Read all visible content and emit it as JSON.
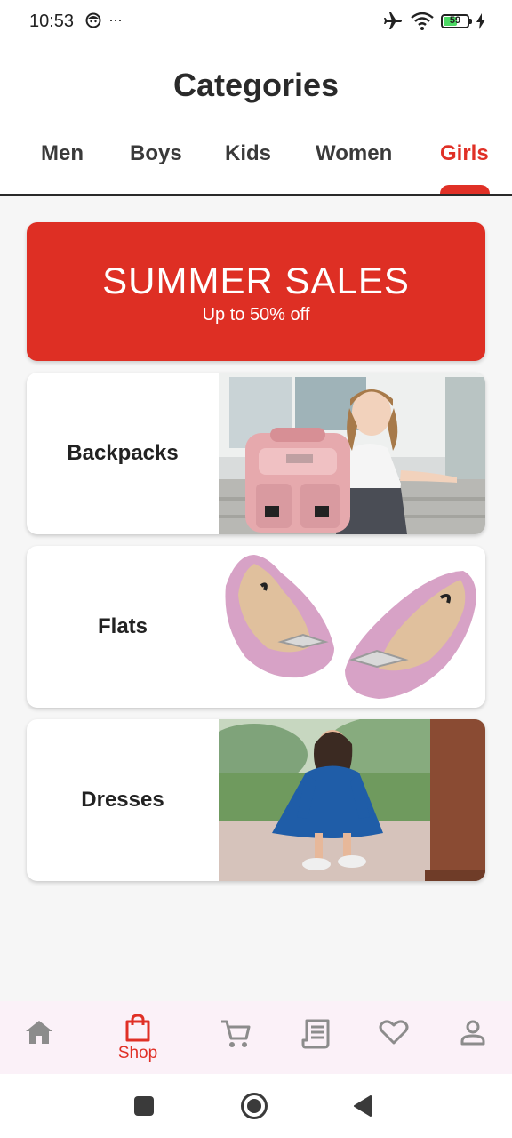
{
  "status_bar": {
    "time": "10:53",
    "more": "···",
    "battery": "59",
    "battery_level": 0.59
  },
  "header": {
    "title": "Categories"
  },
  "tabs": [
    {
      "label": "Men",
      "active": false
    },
    {
      "label": "Boys",
      "active": false
    },
    {
      "label": "Kids",
      "active": false
    },
    {
      "label": "Women",
      "active": false
    },
    {
      "label": "Girls",
      "active": true
    }
  ],
  "banner": {
    "title": "SUMMER SALES",
    "subtitle": "Up to 50% off"
  },
  "categories": [
    {
      "label": "Backpacks",
      "image": "girl-with-pink-backpack-photo"
    },
    {
      "label": "Flats",
      "image": "pink-glitter-flats-photo"
    },
    {
      "label": "Dresses",
      "image": "girl-in-blue-dress-photo"
    }
  ],
  "bottom_nav": {
    "items": [
      {
        "icon": "home-icon",
        "label": "",
        "active": false
      },
      {
        "icon": "shopping-bag-icon",
        "label": "Shop",
        "active": true
      },
      {
        "icon": "cart-icon",
        "label": "",
        "active": false
      },
      {
        "icon": "receipt-icon",
        "label": "",
        "active": false
      },
      {
        "icon": "heart-icon",
        "label": "",
        "active": false
      },
      {
        "icon": "person-icon",
        "label": "",
        "active": false
      }
    ]
  },
  "colors": {
    "accent": "#e03026",
    "banner": "#de2f24",
    "nav_background": "#fbf1f8",
    "icon_gray": "#8c8c8c"
  }
}
